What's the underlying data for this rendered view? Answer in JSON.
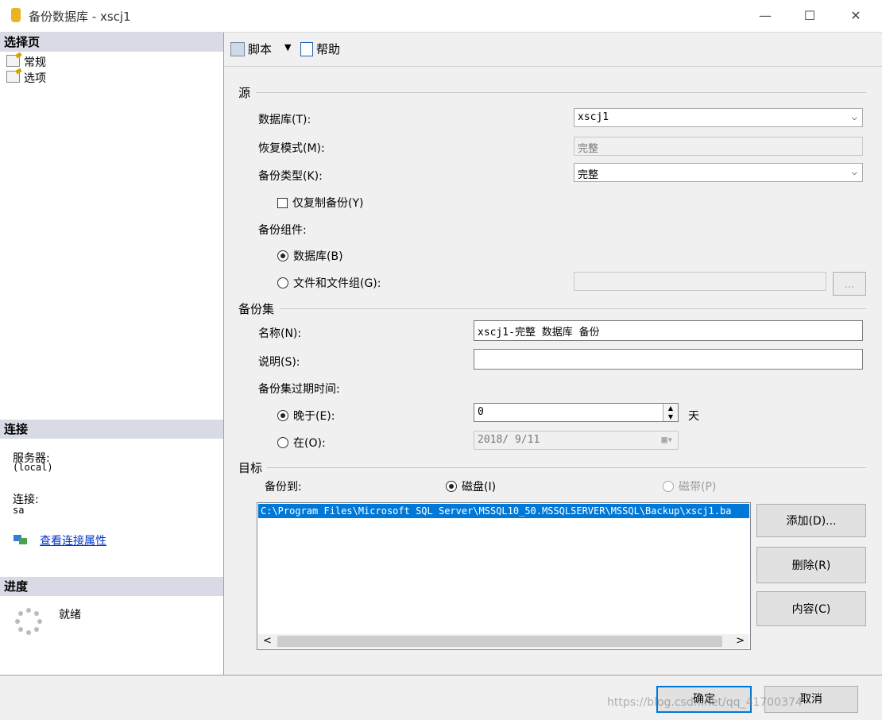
{
  "window": {
    "title": "备份数据库 - xscj1",
    "minimize": "—",
    "maximize": "☐",
    "close": "✕"
  },
  "left": {
    "select_page_header": "选择页",
    "pages": [
      {
        "label": "常规"
      },
      {
        "label": "选项"
      }
    ],
    "connection_header": "连接",
    "server_label": "服务器:",
    "server_value": "(local)",
    "connection_label": "连接:",
    "connection_value": "sa",
    "view_props_link": "查看连接属性",
    "progress_header": "进度",
    "progress_status": "就绪"
  },
  "toolbar": {
    "script_label": "脚本",
    "help_label": "帮助"
  },
  "source": {
    "title": "源",
    "database_label": "数据库(T):",
    "database_value": "xscj1",
    "recovery_label": "恢复模式(M):",
    "recovery_value": "完整",
    "backup_type_label": "备份类型(K):",
    "backup_type_value": "完整",
    "copy_only_label": "仅复制备份(Y)",
    "component_label": "备份组件:",
    "component_database_label": "数据库(B)",
    "component_files_label": "文件和文件组(G):",
    "files_browse_label": "..."
  },
  "backup_set": {
    "title": "备份集",
    "name_label": "名称(N):",
    "name_value": "xscj1-完整 数据库 备份",
    "desc_label": "说明(S):",
    "desc_value": "",
    "expire_label": "备份集过期时间:",
    "after_label": "晚于(E):",
    "after_value": "0",
    "after_unit": "天",
    "on_label": "在(O):",
    "on_value": "2018/ 9/11"
  },
  "destination": {
    "title": "目标",
    "backup_to_label": "备份到:",
    "disk_label": "磁盘(I)",
    "tape_label": "磁带(P)",
    "path_items": [
      "C:\\Program Files\\Microsoft SQL Server\\MSSQL10_50.MSSQLSERVER\\MSSQL\\Backup\\xscj1.ba"
    ],
    "add_label": "添加(D)...",
    "remove_label": "删除(R)",
    "contents_label": "内容(C)"
  },
  "footer": {
    "ok_label": "确定",
    "cancel_label": "取消",
    "watermark": "https://blog.csdn.net/qq_41700374"
  },
  "colors": {
    "accent": "#0078d7",
    "header_bg": "#d8dbe6",
    "pane_bg": "#f0f0f0"
  }
}
